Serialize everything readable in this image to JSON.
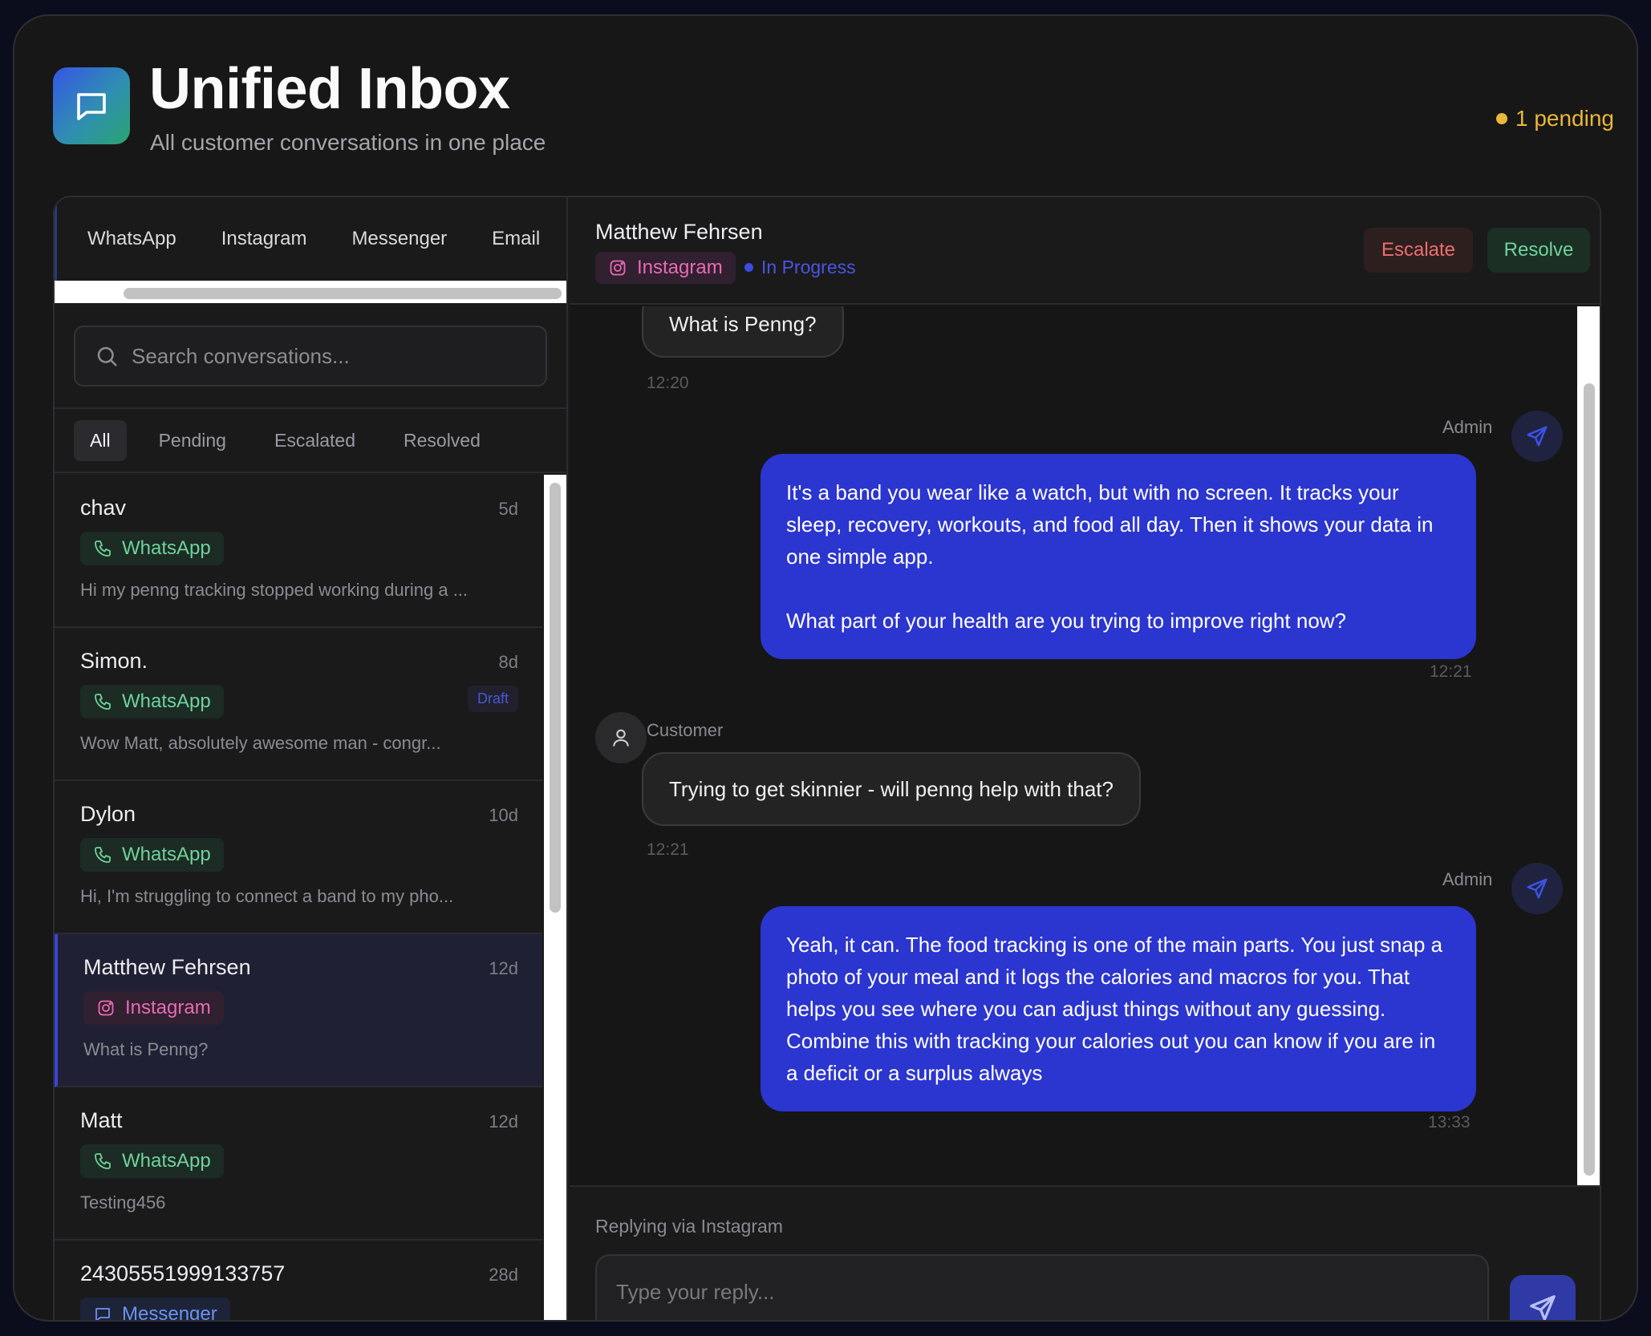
{
  "header": {
    "title": "Unified Inbox",
    "subtitle": "All customer conversations in one place",
    "pending": "1 pending"
  },
  "channel_tabs": [
    "WhatsApp",
    "Instagram",
    "Messenger",
    "Email"
  ],
  "search": {
    "placeholder": "Search conversations..."
  },
  "filters": [
    "All",
    "Pending",
    "Escalated",
    "Resolved"
  ],
  "conversations": [
    {
      "name": "chav",
      "time": "5d",
      "channel": "WhatsApp",
      "preview": "Hi my penng tracking stopped working during a ..."
    },
    {
      "name": "Simon.",
      "time": "8d",
      "channel": "WhatsApp",
      "draft": "Draft",
      "preview": "Wow Matt, absolutely awesome man - congr..."
    },
    {
      "name": "Dylon",
      "time": "10d",
      "channel": "WhatsApp",
      "preview": "Hi, I'm struggling to connect a band to my pho..."
    },
    {
      "name": "Matthew Fehrsen",
      "time": "12d",
      "channel": "Instagram",
      "preview": "What is Penng?"
    },
    {
      "name": "Matt",
      "time": "12d",
      "channel": "WhatsApp",
      "preview": "Testing456"
    },
    {
      "name": "24305551999133757",
      "time": "28d",
      "channel": "Messenger",
      "preview": ""
    }
  ],
  "chat": {
    "contact_name": "Matthew Fehrsen",
    "channel": "Instagram",
    "status": "In Progress",
    "escalate_label": "Escalate",
    "resolve_label": "Resolve",
    "messages": [
      {
        "sender": "",
        "text": "What is Penng?",
        "time": "12:20"
      },
      {
        "sender": "Admin",
        "text": "It's a band you wear like a watch, but with no screen. It tracks your sleep, recovery, workouts, and food all day. Then it shows your data in one simple app.\n\nWhat part of your health are you trying to improve right now?",
        "time": "12:21"
      },
      {
        "sender": "Customer",
        "text": "Trying to get skinnier - will penng help with that?",
        "time": "12:21"
      },
      {
        "sender": "Admin",
        "text": "Yeah, it can. The food tracking is one of the main parts. You just snap a photo of your meal and it logs the calories and macros for you. That helps you see where you can adjust things without any guessing.\nCombine this with tracking your calories out you can know if you are in a deficit or a surplus always",
        "time": "13:33"
      }
    ],
    "reply_via": "Replying via Instagram",
    "reply_placeholder": "Type your reply..."
  }
}
